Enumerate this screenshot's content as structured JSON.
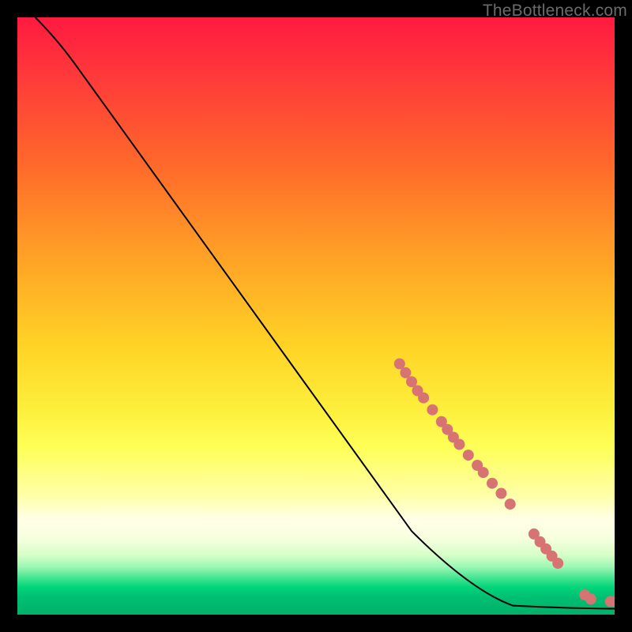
{
  "watermark": "TheBottleneck.com",
  "chart_data": {
    "type": "line",
    "title": "",
    "xlabel": "",
    "ylabel": "",
    "xlim": [
      0,
      100
    ],
    "ylim": [
      0,
      100
    ],
    "curve": [
      {
        "x": 2,
        "y": 100
      },
      {
        "x": 6,
        "y": 95
      },
      {
        "x": 10,
        "y": 89
      },
      {
        "x": 68,
        "y": 9
      },
      {
        "x": 76,
        "y": 3
      },
      {
        "x": 82,
        "y": 1.2
      },
      {
        "x": 90,
        "y": 0.8
      },
      {
        "x": 95,
        "y": 0.8
      },
      {
        "x": 100,
        "y": 0.8
      }
    ],
    "marker_points": [
      {
        "x": 64,
        "y": 42
      },
      {
        "x": 65,
        "y": 40.5
      },
      {
        "x": 66,
        "y": 39
      },
      {
        "x": 67,
        "y": 37.5
      },
      {
        "x": 68,
        "y": 36.3
      },
      {
        "x": 69.5,
        "y": 34.3
      },
      {
        "x": 71,
        "y": 32.3
      },
      {
        "x": 72,
        "y": 31
      },
      {
        "x": 73,
        "y": 29.7
      },
      {
        "x": 74,
        "y": 28.5
      },
      {
        "x": 75.5,
        "y": 26.7
      },
      {
        "x": 77,
        "y": 25
      },
      {
        "x": 78,
        "y": 23.8
      },
      {
        "x": 79.5,
        "y": 22
      },
      {
        "x": 81,
        "y": 20.3
      },
      {
        "x": 82.5,
        "y": 18.5
      },
      {
        "x": 86.5,
        "y": 13.5
      },
      {
        "x": 87.5,
        "y": 12.2
      },
      {
        "x": 88.5,
        "y": 11
      },
      {
        "x": 89.5,
        "y": 9.8
      },
      {
        "x": 90.5,
        "y": 8.6
      },
      {
        "x": 95,
        "y": 3.3
      },
      {
        "x": 96,
        "y": 2.6
      },
      {
        "x": 99.3,
        "y": 2.2
      },
      {
        "x": 100,
        "y": 2.2
      }
    ],
    "marker_color": "#d87373"
  }
}
